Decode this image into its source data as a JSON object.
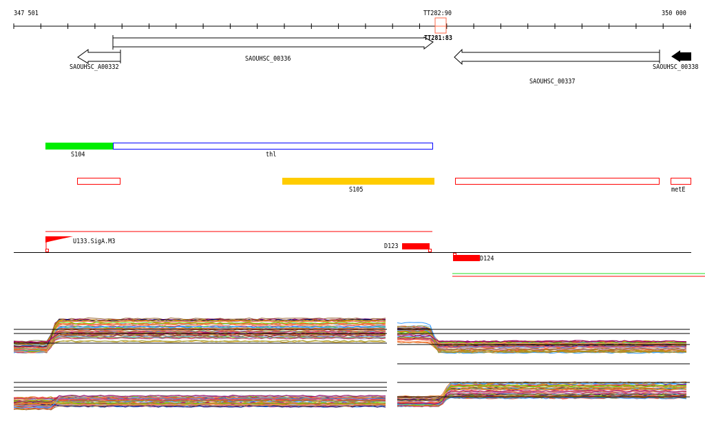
{
  "ruler": {
    "start_label": "347 501",
    "end_label": "350 000",
    "marker_label": "TT282:90",
    "marker_label_2": "TT281:83"
  },
  "genes": [
    {
      "name": "SAOUHSC_A00332",
      "strand": "-"
    },
    {
      "name": "SAOUHSC_00336",
      "strand": "+"
    },
    {
      "name": "SAOUHSC_00337",
      "strand": "-"
    },
    {
      "name": "SAOUHSC_00338",
      "strand": "-"
    }
  ],
  "features": {
    "s104": "S104",
    "thl": "thl",
    "s105": "S105",
    "metE": "metE",
    "u133": "U133.SigA.M3",
    "d123": "D123",
    "d124": "D124"
  },
  "colors": {
    "green": "#00ee00",
    "blue": "#0000ff",
    "red": "#ff0000",
    "gold": "#ffcc00",
    "marker": "#ff6644"
  },
  "expression_palette": [
    "#ff6633",
    "#cc9900",
    "#66dd00",
    "#3399ff",
    "#cc3366",
    "#996633",
    "#999933",
    "#ff9966",
    "#990066",
    "#66bbff",
    "#ee5533",
    "#bb8800",
    "#cc66aa",
    "#888844",
    "#ff4444",
    "#aa99cc",
    "#000066",
    "#dd7722"
  ]
}
